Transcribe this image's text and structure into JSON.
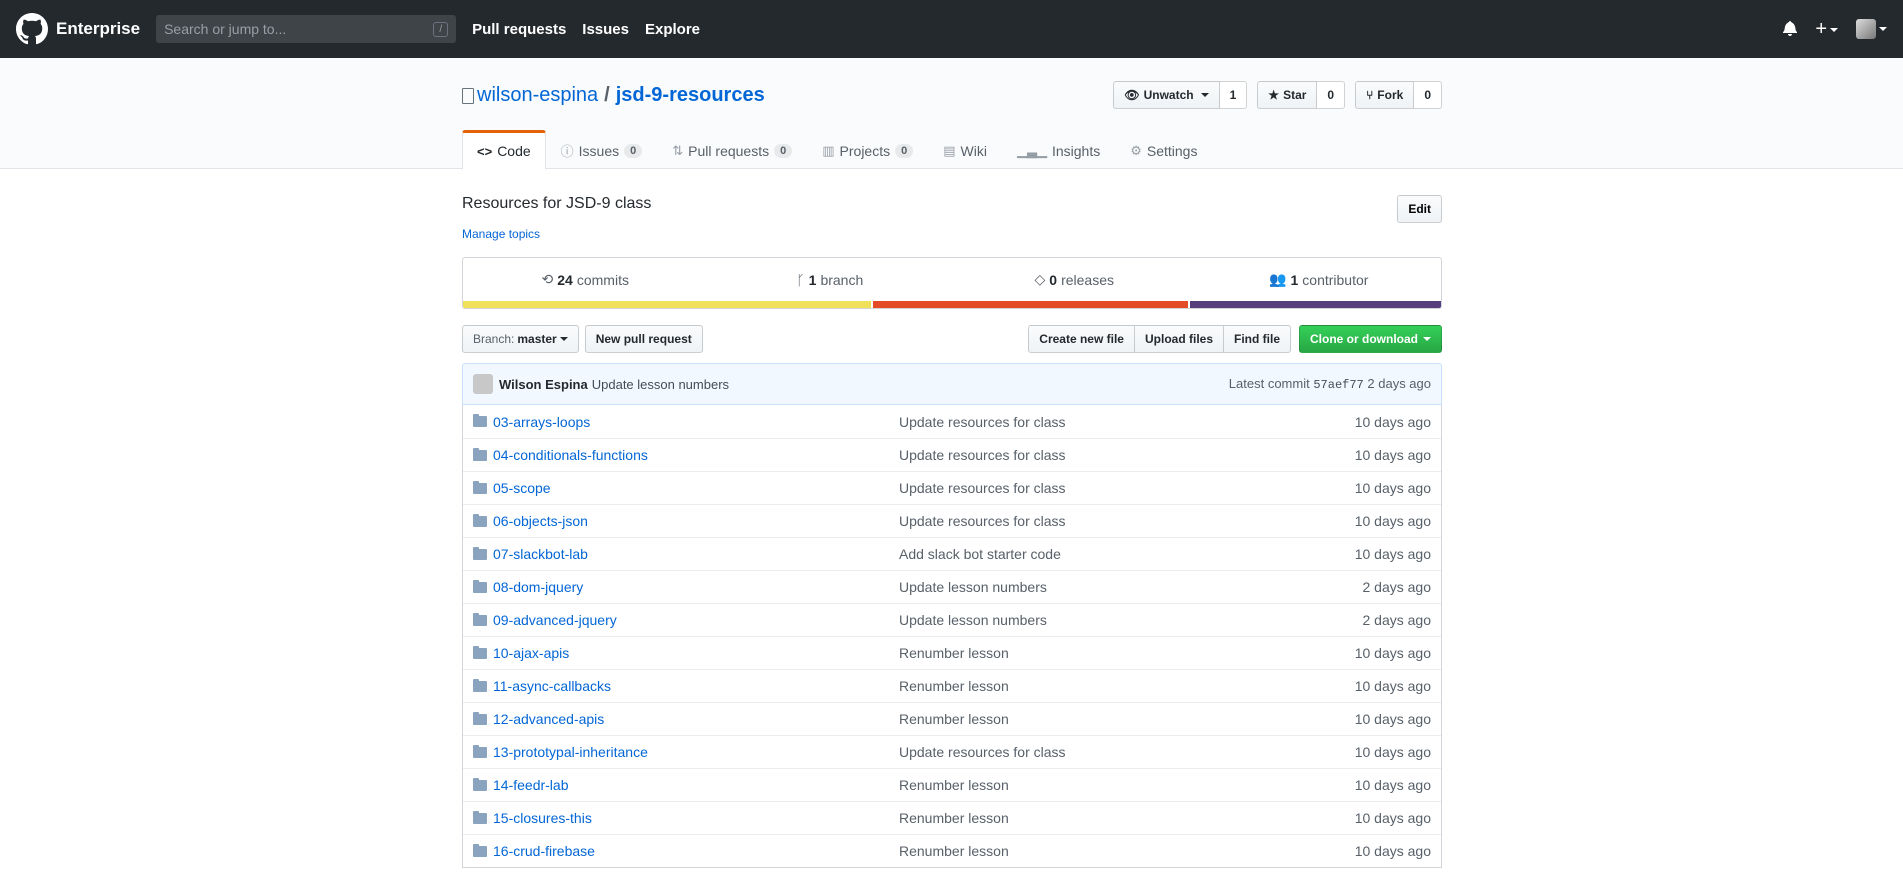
{
  "header": {
    "brand": "Enterprise",
    "search_placeholder": "Search or jump to...",
    "search_shortcut": "/",
    "nav": [
      "Pull requests",
      "Issues",
      "Explore"
    ]
  },
  "repo": {
    "owner": "wilson-espina",
    "separator": "/",
    "name": "jsd-9-resources",
    "watch_label": "Unwatch",
    "watch_count": "1",
    "star_label": "Star",
    "star_count": "0",
    "fork_label": "Fork",
    "fork_count": "0"
  },
  "tabs": [
    {
      "label": "Code",
      "icon": "code-icon"
    },
    {
      "label": "Issues",
      "count": "0",
      "icon": "issue-icon"
    },
    {
      "label": "Pull requests",
      "count": "0",
      "icon": "pull-request-icon"
    },
    {
      "label": "Projects",
      "count": "0",
      "icon": "project-icon"
    },
    {
      "label": "Wiki",
      "icon": "book-icon"
    },
    {
      "label": "Insights",
      "icon": "graph-icon"
    },
    {
      "label": "Settings",
      "icon": "gear-icon"
    }
  ],
  "description": "Resources for JSD-9 class",
  "edit_label": "Edit",
  "manage_topics": "Manage topics",
  "summary": {
    "commits_count": "24",
    "commits_label": "commits",
    "branch_count": "1",
    "branch_label": "branch",
    "releases_count": "0",
    "releases_label": "releases",
    "contributors_count": "1",
    "contributors_label": "contributor"
  },
  "languages": [
    {
      "color": "#f1e05a",
      "percent": 41.9
    },
    {
      "color": "#e34c26",
      "percent": 32.3
    },
    {
      "color": "#563d7c",
      "percent": 25.8
    }
  ],
  "filebar": {
    "branch_label": "Branch:",
    "branch_value": "master",
    "new_pr": "New pull request",
    "create_file": "Create new file",
    "upload_files": "Upload files",
    "find_file": "Find file",
    "clone": "Clone or download"
  },
  "latest_commit": {
    "author": "Wilson Espina",
    "message": "Update lesson numbers",
    "label": "Latest commit",
    "sha": "57aef77",
    "age": "2 days ago"
  },
  "files": [
    {
      "name": "03-arrays-loops",
      "message": "Update resources for class",
      "age": "10 days ago"
    },
    {
      "name": "04-conditionals-functions",
      "message": "Update resources for class",
      "age": "10 days ago"
    },
    {
      "name": "05-scope",
      "message": "Update resources for class",
      "age": "10 days ago"
    },
    {
      "name": "06-objects-json",
      "message": "Update resources for class",
      "age": "10 days ago"
    },
    {
      "name": "07-slackbot-lab",
      "message": "Add slack bot starter code",
      "age": "10 days ago"
    },
    {
      "name": "08-dom-jquery",
      "message": "Update lesson numbers",
      "age": "2 days ago"
    },
    {
      "name": "09-advanced-jquery",
      "message": "Update lesson numbers",
      "age": "2 days ago"
    },
    {
      "name": "10-ajax-apis",
      "message": "Renumber lesson",
      "age": "10 days ago"
    },
    {
      "name": "11-async-callbacks",
      "message": "Renumber lesson",
      "age": "10 days ago"
    },
    {
      "name": "12-advanced-apis",
      "message": "Renumber lesson",
      "age": "10 days ago"
    },
    {
      "name": "13-prototypal-inheritance",
      "message": "Update resources for class",
      "age": "10 days ago"
    },
    {
      "name": "14-feedr-lab",
      "message": "Renumber lesson",
      "age": "10 days ago"
    },
    {
      "name": "15-closures-this",
      "message": "Renumber lesson",
      "age": "10 days ago"
    },
    {
      "name": "16-crud-firebase",
      "message": "Renumber lesson",
      "age": "10 days ago"
    }
  ]
}
